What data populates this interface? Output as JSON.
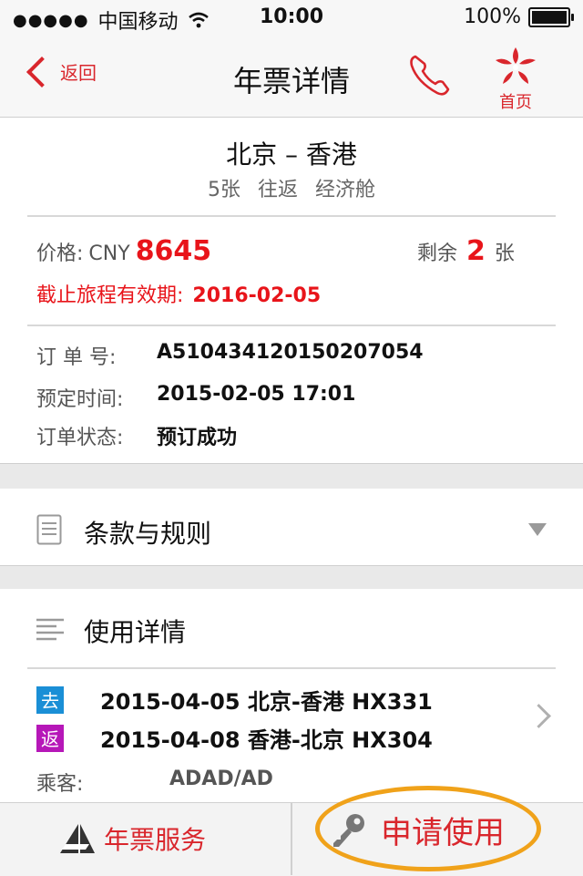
{
  "status_bar": {
    "signal_dots": "●●●●●",
    "carrier": "中国移动",
    "time": "10:00",
    "battery_pct": "100%"
  },
  "nav": {
    "back_label": "返回",
    "title": "年票详情",
    "home_label": "首页",
    "icons": [
      "chevron-left-icon",
      "phone-icon",
      "bauhinia-logo-icon"
    ]
  },
  "route": {
    "title": "北京 – 香港",
    "tickets": "5张",
    "trip_type": "往返",
    "cabin": "经济舱"
  },
  "price": {
    "label": "价格:",
    "currency": "CNY",
    "amount": "8645",
    "remain_label": "剩余",
    "remain_count": "2",
    "remain_unit": "张",
    "deadline_label": "截止旅程有效期:",
    "deadline_date": "2016-02-05"
  },
  "order": {
    "number_label": "订 单 号:",
    "number": "A510434120150207054",
    "time_label": "预定时间:",
    "time": "2015-02-05 17:01",
    "status_label": "订单状态:",
    "status": "预订成功"
  },
  "terms": {
    "label": "条款与规则"
  },
  "usage": {
    "label": "使用详情",
    "trips": [
      {
        "badge": "去",
        "badge_color": "#1a8fd6",
        "text": "2015-04-05 北京-香港 HX331"
      },
      {
        "badge": "返",
        "badge_color": "#b617b8",
        "text": "2015-04-08 香港-北京 HX304"
      }
    ],
    "passenger_label": "乘客:",
    "passenger": "ADAD/AD"
  },
  "tabbar": {
    "service_label": "年票服务",
    "apply_label": "申请使用"
  },
  "colors": {
    "accent_red": "#d9262c",
    "highlight_red": "#e8141a",
    "ring_orange": "#f0a21a"
  }
}
